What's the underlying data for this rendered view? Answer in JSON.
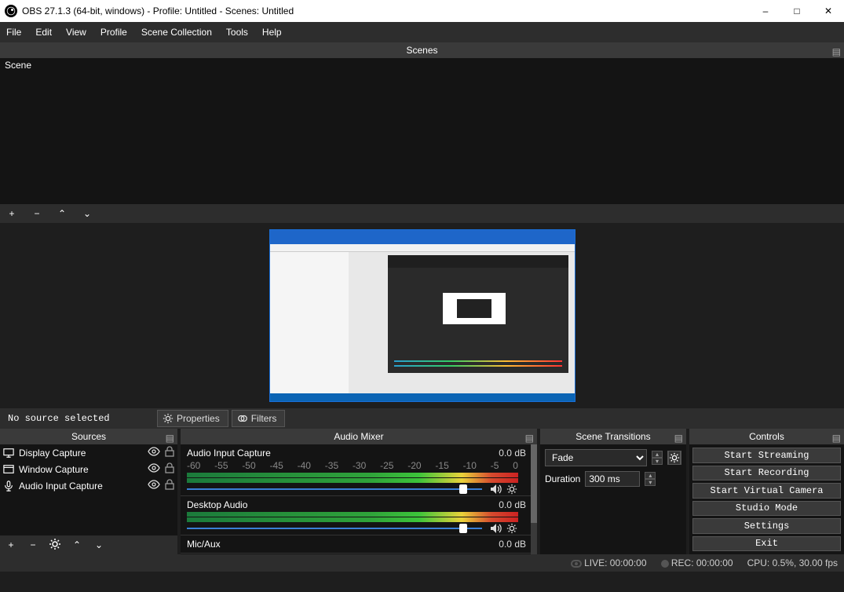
{
  "title": "OBS 27.1.3 (64-bit, windows) - Profile: Untitled - Scenes: Untitled",
  "menubar": [
    "File",
    "Edit",
    "View",
    "Profile",
    "Scene Collection",
    "Tools",
    "Help"
  ],
  "scenesPanel": {
    "title": "Scenes",
    "items": [
      "Scene"
    ]
  },
  "midbar": {
    "nosrc": "No source selected",
    "props": "Properties",
    "filters": "Filters"
  },
  "sources": {
    "title": "Sources",
    "items": [
      {
        "icon": "monitor",
        "name": "Display Capture"
      },
      {
        "icon": "window",
        "name": "Window Capture"
      },
      {
        "icon": "mic",
        "name": "Audio Input Capture"
      }
    ]
  },
  "mixer": {
    "title": "Audio Mixer",
    "ticks": [
      "-60",
      "-55",
      "-50",
      "-45",
      "-40",
      "-35",
      "-30",
      "-25",
      "-20",
      "-15",
      "-10",
      "-5",
      "0"
    ],
    "channels": [
      {
        "name": "Audio Input Capture",
        "db": "0.0 dB",
        "fill": 100,
        "knob": 94
      },
      {
        "name": "Desktop Audio",
        "db": "0.0 dB",
        "fill": 100,
        "knob": 94,
        "short": true
      },
      {
        "name": "Mic/Aux",
        "db": "0.0 dB",
        "fill": 0,
        "last": true
      }
    ]
  },
  "transitions": {
    "title": "Scene Transitions",
    "type": "Fade",
    "durationLabel": "Duration",
    "duration": "300 ms"
  },
  "controls": {
    "title": "Controls",
    "buttons": [
      "Start Streaming",
      "Start Recording",
      "Start Virtual Camera",
      "Studio Mode",
      "Settings",
      "Exit"
    ]
  },
  "status": {
    "live": "LIVE: 00:00:00",
    "rec": "REC: 00:00:00",
    "cpu": "CPU: 0.5%, 30.00 fps"
  }
}
